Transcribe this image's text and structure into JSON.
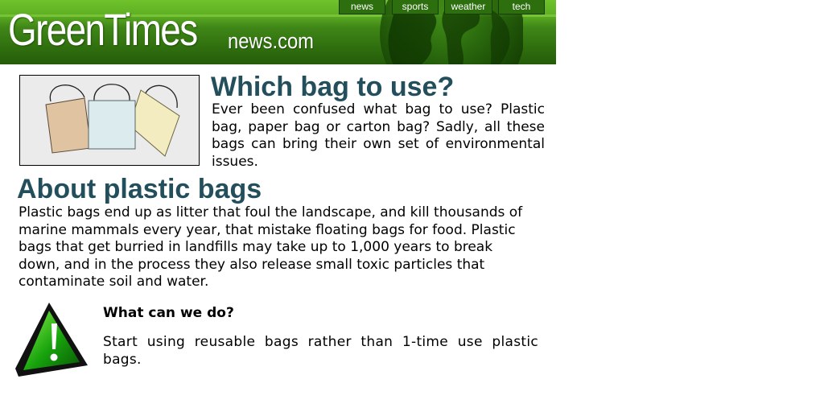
{
  "header": {
    "logo_main": "GreenTimes",
    "logo_sub": "news.com"
  },
  "nav": {
    "items": [
      "news",
      "sports",
      "weather",
      "tech"
    ]
  },
  "article": {
    "bag_heading": "Which bag to use?",
    "bag_text": "Ever been confused what bag to use? Plastic bag, paper bag or carton bag? Sadly, all these bags can bring their own set of environmental issues.",
    "plastic_heading": "About plastic bags",
    "plastic_text": "Plastic bags end up as litter that foul the landscape, and kill thousands of marine mammals every year, that mistake floating bags for food. Plastic bags that get burried in landfills may take up to 1,000 years to break down, and in the process they also release small toxic particles that contaminate soil and water."
  },
  "warning": {
    "icon": "exclamation-warning-icon",
    "title": "What can we do?",
    "text": "Start using reusable bags rather than 1-time use plastic bags."
  },
  "colors": {
    "header_green": "#4a9a1c",
    "nav_tab": "#2d6f0e",
    "heading": "#234f5c"
  }
}
